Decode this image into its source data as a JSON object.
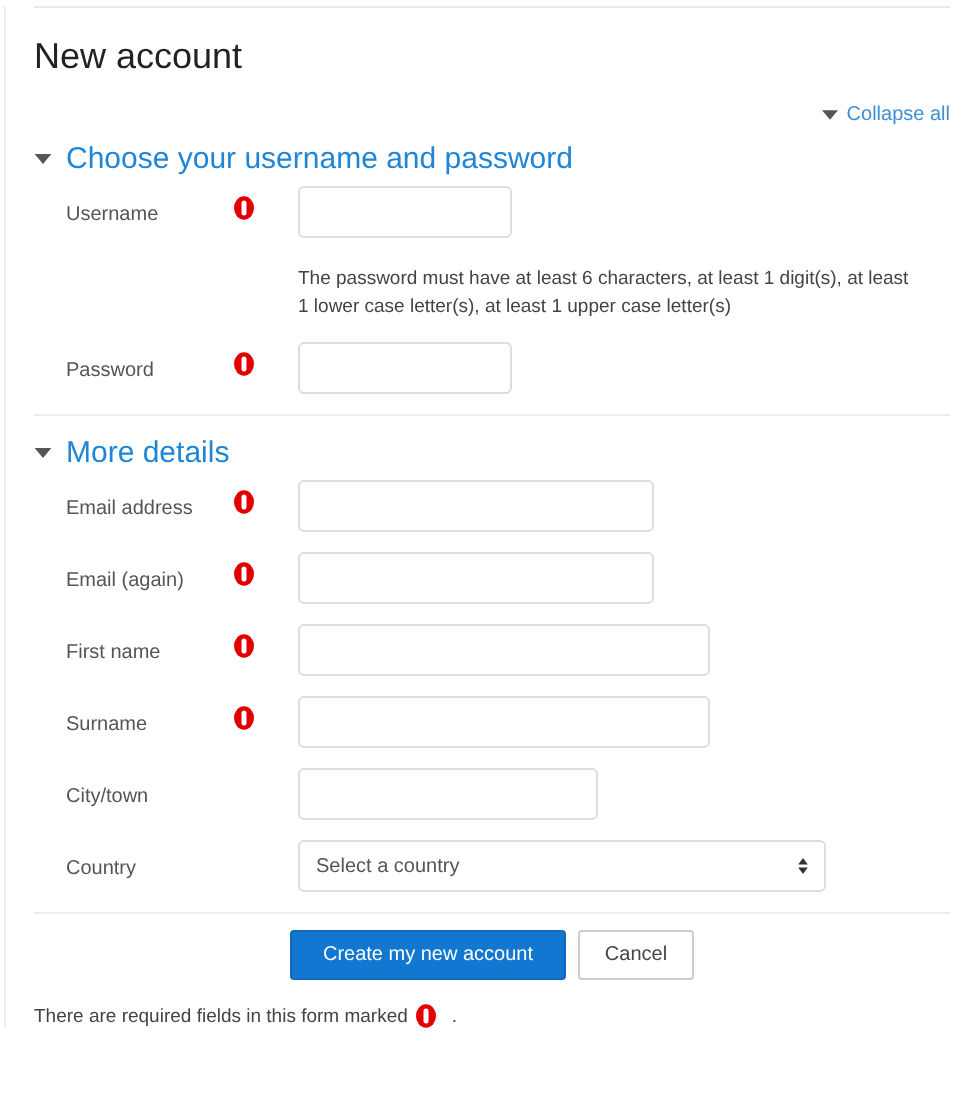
{
  "title": "New account",
  "collapse_all": {
    "label": "Collapse all"
  },
  "sections": [
    {
      "title": "Choose your username and password",
      "expanded": true,
      "fields": [
        {
          "kind": "text",
          "label": "Username",
          "required": true
        },
        {
          "kind": "help",
          "text": "The password must have at least 6 characters, at least 1 digit(s), at least 1 lower case letter(s), at least 1 upper case letter(s)"
        },
        {
          "kind": "text",
          "label": "Password",
          "required": true
        }
      ]
    },
    {
      "title": "More details",
      "expanded": true,
      "fields": [
        {
          "kind": "text",
          "label": "Email address",
          "required": true
        },
        {
          "kind": "text",
          "label": "Email (again)",
          "required": true
        },
        {
          "kind": "text",
          "label": "First name",
          "required": true
        },
        {
          "kind": "text",
          "label": "Surname",
          "required": true
        },
        {
          "kind": "text",
          "label": "City/town",
          "required": false
        },
        {
          "kind": "select",
          "label": "Country",
          "required": false,
          "placeholder": "Select a country"
        }
      ]
    }
  ],
  "buttons": [
    {
      "label": "Create my new account",
      "primary": true
    },
    {
      "label": "Cancel",
      "primary": false
    }
  ],
  "footer": {
    "text": "There are required fields in this form marked",
    "end": "."
  }
}
